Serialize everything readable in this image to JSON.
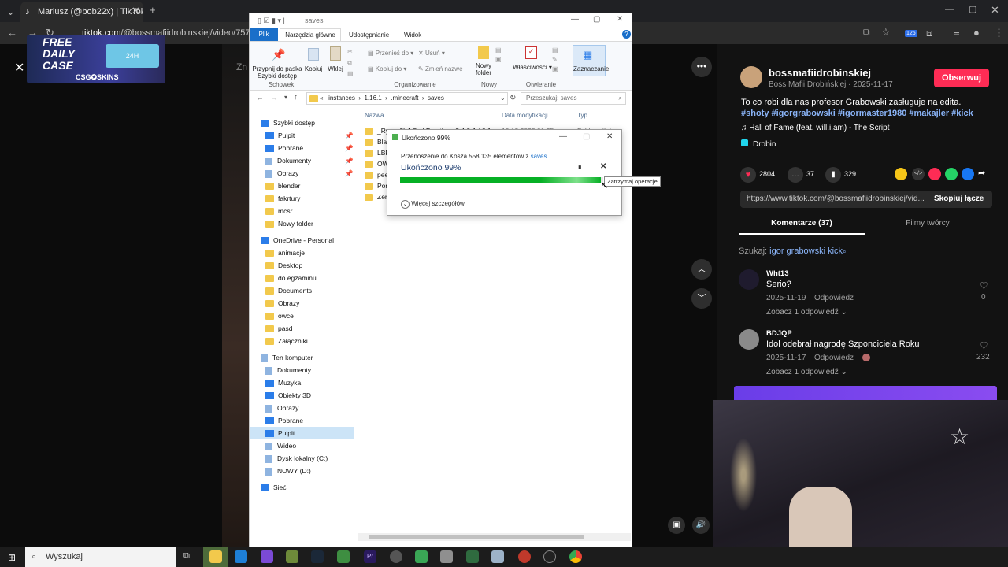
{
  "browser": {
    "tab_title": "Mariusz (@bob22x) | TikTok",
    "url_host": "tiktok.com",
    "url_path": "/@bossmafiidrobinskiej/video/75736360",
    "extension_badge": "126"
  },
  "ad": {
    "line1": "FREE",
    "line2": "DAILY",
    "line3": "CASE",
    "brand": "CSG✪SKINS",
    "badge": "24H"
  },
  "video": {
    "partial_text": "Zn"
  },
  "explorer": {
    "title": "saves",
    "tabs": [
      "Plik",
      "Narzędzia główne",
      "Udostępnianie",
      "Widok"
    ],
    "ribbon": {
      "pin": "Przypnij do paska Szybki dostęp",
      "copy": "Kopiuj",
      "paste": "Wklej",
      "move_to": "Przenieś do",
      "copy_to": "Kopiuj do",
      "delete": "Usuń",
      "rename": "Zmień nazwę",
      "new_folder": "Nowy folder",
      "properties": "Właściwości",
      "select": "Zaznaczanie",
      "group_clipboard": "Schowek",
      "group_organize": "Organizowanie",
      "group_new": "Nowy",
      "group_open": "Otwieranie"
    },
    "breadcrumb": [
      "«",
      "instances",
      "1.16.1",
      ".minecraft",
      "saves"
    ],
    "search_placeholder": "Przeszukaj: saves",
    "columns": [
      "Nazwa",
      "Data modyfikacji",
      "Typ"
    ],
    "files": [
      "_Rysas2k4 End Practice v2.4.0-1.16.1",
      "Blaz",
      "LBP",
      "OW",
      "peep",
      "Port",
      "Zero"
    ],
    "first_row_date": "10.12.2025 01:25",
    "first_row_type": "Folder plików",
    "sidebar": {
      "quick_access": "Szybki dostęp",
      "quick_items": [
        "Pulpit",
        "Pobrane",
        "Dokumenty",
        "Obrazy",
        "blender",
        "fakrtury",
        "mcsr",
        "Nowy folder"
      ],
      "onedrive": "OneDrive - Personal",
      "onedrive_items": [
        "animacje",
        "Desktop",
        "do egzaminu",
        "Documents",
        "Obrazy",
        "owce",
        "pasd",
        "Załączniki"
      ],
      "this_pc": "Ten komputer",
      "pc_items": [
        "Dokumenty",
        "Muzyka",
        "Obiekty 3D",
        "Obrazy",
        "Pobrane",
        "Pulpit",
        "Wideo",
        "Dysk lokalny (C:)",
        "NOWY (D:)"
      ],
      "network": "Sieć"
    }
  },
  "dialog": {
    "title": "Ukończono 99%",
    "line1_prefix": "Przenoszenie do Kosza 558 135 elementów z",
    "line1_link": "saves",
    "status": "Ukończono 99%",
    "progress": 0.99,
    "details": "Więcej szczegółów",
    "tooltip": "Zatrzymaj operacje"
  },
  "panel": {
    "username": "bossmafiidrobinskiej",
    "subtitle": "Boss Mafii Drobińskiej · 2025-11-17",
    "follow": "Obserwuj",
    "caption": "To co robi dla nas profesor Grabowski zasługuje na edita.",
    "hashtags": "#shoty #igorgrabowski #igormaster1980 #makajler #kick",
    "music": "Hall of Fame (feat. will.i.am) - The Script",
    "effect": "Drobin",
    "likes": "2804",
    "comments_count": "37",
    "saves": "329",
    "share_link": "https://www.tiktok.com/@bossmafiidrobinskiej/vid...",
    "copy_link": "Skopiuj łącze",
    "tab_comments": "Komentarze (37)",
    "tab_creator": "Filmy twórcy",
    "search_prefix": "Szukaj:",
    "search_term": "igor grabowski kick",
    "comments": [
      {
        "user": "Wht13",
        "text": "Serio?",
        "date": "2025-11-19",
        "reply": "Odpowiedz",
        "likes": "0",
        "more": "Zobacz 1 odpowiedź"
      },
      {
        "user": "BDJQP",
        "text": "Idol odebrał nagrodę Szponciciela Roku",
        "date": "2025-11-17",
        "reply": "Odpowiedz",
        "likes": "232",
        "more": "Zobacz 1 odpowiedź"
      }
    ]
  },
  "taskbar": {
    "search": "Wyszukaj"
  }
}
